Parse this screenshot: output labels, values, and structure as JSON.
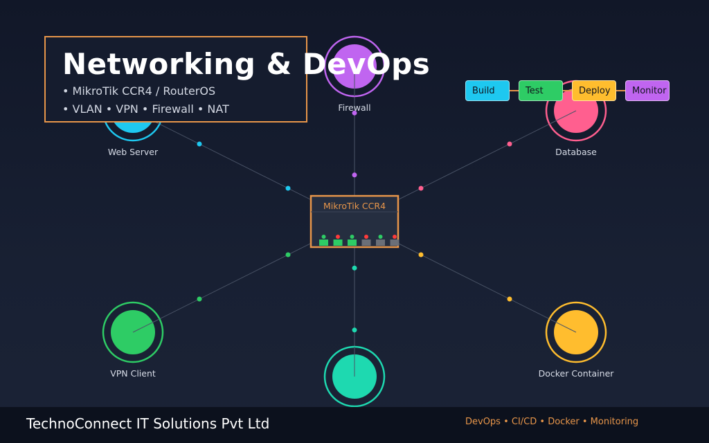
{
  "title": {
    "heading": "Networking & DevOps",
    "lines": [
      "• MikroTik CCR4 / RouterOS",
      "• VLAN • VPN • Firewall • NAT"
    ]
  },
  "router": {
    "label": "MikroTik CCR4",
    "color": "#e8964a"
  },
  "nodes": [
    {
      "id": "web-server",
      "label": "Web Server",
      "color": "#1ec8f0"
    },
    {
      "id": "firewall",
      "label": "Firewall",
      "color": "#c065f0"
    },
    {
      "id": "database",
      "label": "Database",
      "color": "#ff5f8f"
    },
    {
      "id": "vpn-client",
      "label": "VPN Client",
      "color": "#2ecc65"
    },
    {
      "id": "monitoring-node",
      "label": "",
      "color": "#1ed9b0"
    },
    {
      "id": "docker-container",
      "label": "Docker Container",
      "color": "#ffbd2e"
    }
  ],
  "pipeline": [
    {
      "label": "Build",
      "color": "#1ec8f0"
    },
    {
      "label": "Test",
      "color": "#2ecc65"
    },
    {
      "label": "Deploy",
      "color": "#ffbd2e"
    },
    {
      "label": "Monitor",
      "color": "#c065f0"
    }
  ],
  "footer": {
    "company": "TechnoConnect IT Solutions Pvt Ltd",
    "tags": "DevOps • CI/CD • Docker • Monitoring"
  }
}
